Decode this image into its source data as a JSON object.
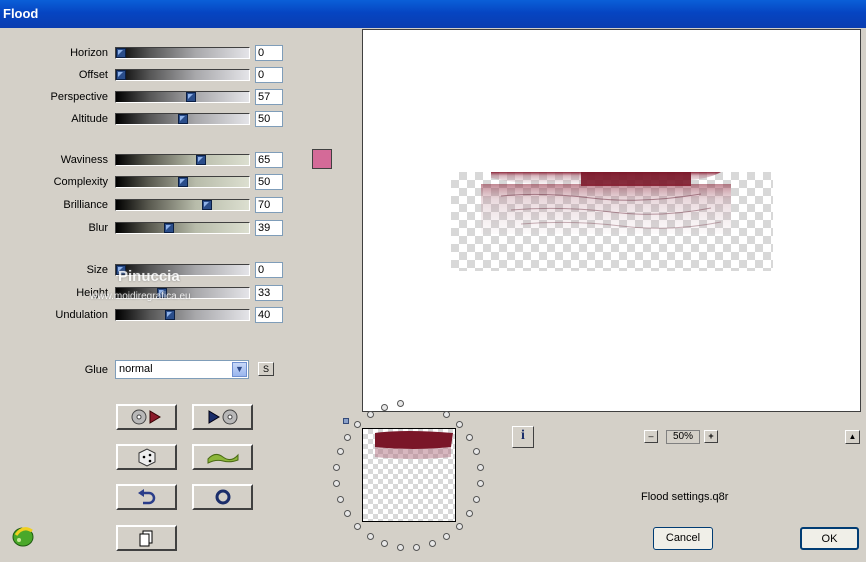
{
  "window": {
    "title": "Flood"
  },
  "group1": [
    {
      "label": "Horizon",
      "value": "0",
      "fraction": 0.0
    },
    {
      "label": "Offset",
      "value": "0",
      "fraction": 0.0
    },
    {
      "label": "Perspective",
      "value": "57",
      "fraction": 0.57
    },
    {
      "label": "Altitude",
      "value": "50",
      "fraction": 0.5
    }
  ],
  "group2": [
    {
      "label": "Waviness",
      "value": "65",
      "fraction": 0.65
    },
    {
      "label": "Complexity",
      "value": "50",
      "fraction": 0.5
    },
    {
      "label": "Brilliance",
      "value": "70",
      "fraction": 0.7
    },
    {
      "label": "Blur",
      "value": "39",
      "fraction": 0.39
    }
  ],
  "group3": [
    {
      "label": "Size",
      "value": "0",
      "fraction": 0.0
    },
    {
      "label": "Height",
      "value": "33",
      "fraction": 0.33
    },
    {
      "label": "Undulation",
      "value": "40",
      "fraction": 0.4
    }
  ],
  "color_swatch": "#d46a98",
  "glue": {
    "label": "Glue",
    "value": "normal",
    "side_button": "S"
  },
  "zoom": {
    "value": "50%",
    "minus": "–",
    "plus": "+"
  },
  "info_button": "i",
  "scroll_up": "▲",
  "settings_file": "Flood settings.q8r",
  "buttons": {
    "cancel": "Cancel",
    "ok": "OK"
  },
  "watermark": {
    "name": "Pinuccia",
    "site": "www.moidiregrafica.eu"
  }
}
